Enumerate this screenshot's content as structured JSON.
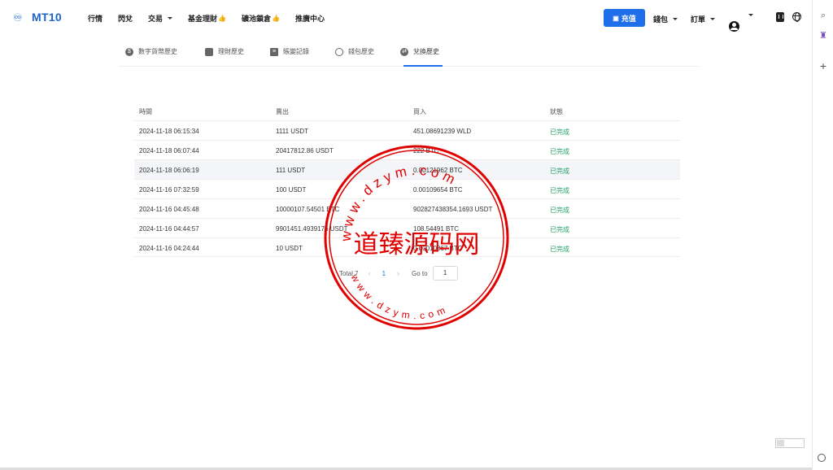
{
  "brand": {
    "name": "MT10"
  },
  "nav": {
    "items": [
      {
        "label": "行情",
        "has_caret": false,
        "badge": ""
      },
      {
        "label": "閃兌",
        "has_caret": false,
        "badge": ""
      },
      {
        "label": "交易",
        "has_caret": true,
        "badge": ""
      },
      {
        "label": "基金理財",
        "has_caret": false,
        "badge": "👍"
      },
      {
        "label": "礦池鎖倉",
        "has_caret": false,
        "badge": "👍"
      },
      {
        "label": "推廣中心",
        "has_caret": false,
        "badge": ""
      }
    ],
    "recharge_label": "充值",
    "wallet_label": "錢包",
    "orders_label": "訂單"
  },
  "tabs": [
    {
      "label": "數字貨幣歷史",
      "icon": "dollar-icon",
      "active": false
    },
    {
      "label": "理財歷史",
      "icon": "piggy-bank-icon",
      "active": false
    },
    {
      "label": "賬變記錄",
      "icon": "ledger-icon",
      "active": false
    },
    {
      "label": "錢包歷史",
      "icon": "history-icon",
      "active": false
    },
    {
      "label": "兌換歷史",
      "icon": "exchange-icon",
      "active": true
    }
  ],
  "table": {
    "headers": [
      "時間",
      "賣出",
      "買入",
      "狀態"
    ],
    "rows": [
      {
        "time": "2024-11-18 06:15:34",
        "sell": "1111 USDT",
        "buy": "451.08691239 WLD",
        "status": "已完成"
      },
      {
        "time": "2024-11-18 06:07:44",
        "sell": "20417812.86 USDT",
        "buy": "222 BTC",
        "status": "已完成"
      },
      {
        "time": "2024-11-18 06:06:19",
        "sell": "111 USDT",
        "buy": "0.00121962 BTC",
        "status": "已完成"
      },
      {
        "time": "2024-11-16 07:32:59",
        "sell": "100 USDT",
        "buy": "0.00109654 BTC",
        "status": "已完成"
      },
      {
        "time": "2024-11-16 04:45:48",
        "sell": "10000107.54501 BTC",
        "buy": "902827438354.1693 USDT",
        "status": "已完成"
      },
      {
        "time": "2024-11-16 04:44:57",
        "sell": "9901451.4939176 USDT",
        "buy": "108.54491 BTC",
        "status": "已完成"
      },
      {
        "time": "2024-11-16 04:24:44",
        "sell": "10 USDT",
        "buy": "0.00010867 BTC",
        "status": "已完成"
      }
    ]
  },
  "pagination": {
    "total_text": "Total 7",
    "current_page": "1",
    "goto_label": "Go to",
    "goto_value": "1"
  },
  "stamp": {
    "center_text": "道臻源码网",
    "ring_top": "www.dzym.com",
    "ring_bottom": "www.dzym.com",
    "color": "#e00000"
  },
  "colors": {
    "accent": "#1f6feb",
    "status_done": "#21a366"
  }
}
